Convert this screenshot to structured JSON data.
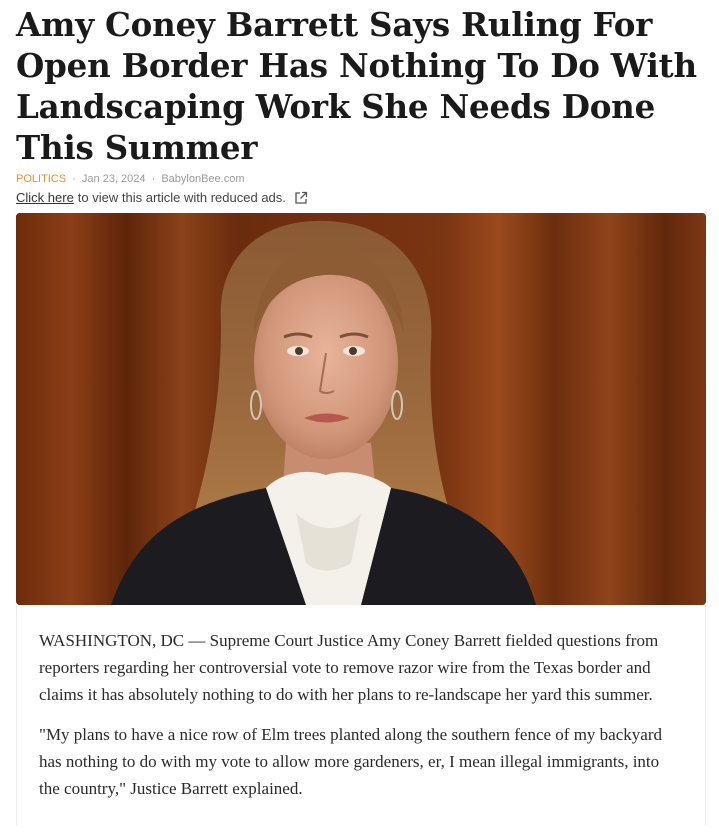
{
  "article": {
    "headline": "Amy Coney Barrett Says Ruling For Open Border Has Nothing To Do With Landscaping Work She Needs Done This Summer",
    "category": "POLITICS",
    "date": "Jan 23, 2024",
    "source": "BabylonBee.com",
    "separator": "·",
    "reduced_ads": {
      "link_text": "Click here",
      "rest_text": "to view this article with reduced ads.",
      "icon": "external-link-icon"
    },
    "hero_image": {
      "subject": "photo-of-justice-speaking"
    },
    "paragraphs": [
      "WASHINGTON, DC — Supreme Court Justice Amy Coney Barrett fielded questions from reporters regarding her controversial vote to remove razor wire from the Texas border and claims it has absolutely nothing to do with her plans to re-landscape her yard this summer.",
      "\"My plans to have a nice row of Elm trees planted along the southern fence of my backyard has nothing to do with my vote to allow more gardeners, er, I mean illegal immigrants, into the country,\" Justice Barrett explained."
    ]
  },
  "colors": {
    "category": "#e0962a",
    "meta": "#9a9a9a",
    "curtain": "#7a3a14"
  }
}
